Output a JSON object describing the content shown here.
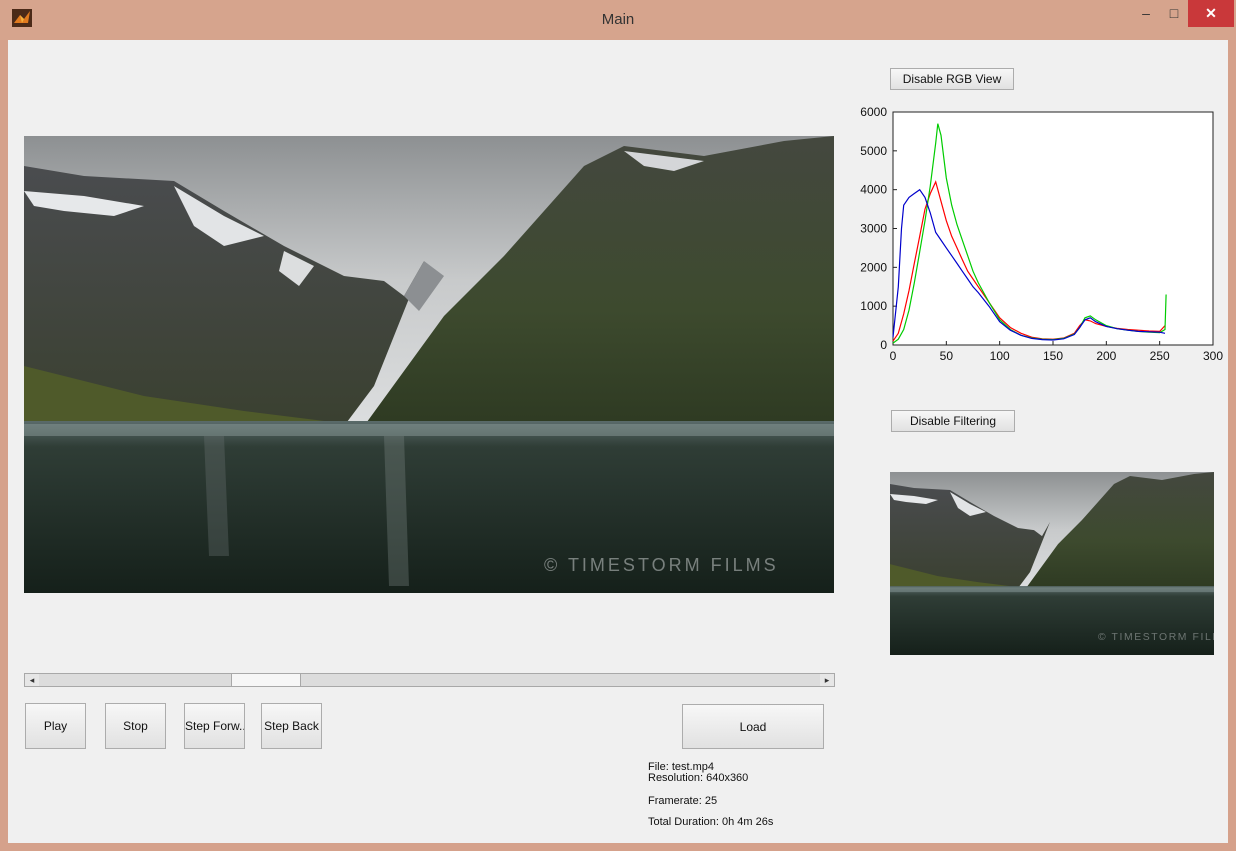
{
  "window": {
    "title": "Main",
    "controls": {
      "minimize": "–",
      "maximize": "□",
      "close": "✕"
    }
  },
  "buttons": {
    "rgb_view": "Disable RGB View",
    "filtering": "Disable Filtering",
    "play": "Play",
    "stop": "Stop",
    "step_forward": "Step Forw...",
    "step_back": "Step Back",
    "load": "Load"
  },
  "video": {
    "watermark": "© TIMESTORM FILMS"
  },
  "slider": {
    "left_arrow": "◂",
    "right_arrow": "▸",
    "position": 0.27
  },
  "file_info": {
    "file": "File: test.mp4",
    "resolution": "Resolution: 640x360",
    "framerate": "Framerate: 25",
    "duration": "Total Duration: 0h 4m 26s"
  },
  "chart_data": {
    "type": "line",
    "xlim": [
      0,
      300
    ],
    "ylim": [
      0,
      6000
    ],
    "x_ticks": [
      "0",
      "50",
      "100",
      "150",
      "200",
      "250",
      "300"
    ],
    "y_ticks": [
      "0",
      "1000",
      "2000",
      "3000",
      "4000",
      "5000",
      "6000"
    ],
    "grid": false,
    "series": [
      {
        "color": "#ff0000",
        "x": [
          0,
          5,
          10,
          15,
          20,
          25,
          30,
          35,
          40,
          45,
          50,
          55,
          60,
          65,
          70,
          75,
          80,
          90,
          100,
          110,
          120,
          130,
          140,
          150,
          160,
          170,
          175,
          180,
          185,
          190,
          200,
          210,
          220,
          230,
          240,
          250,
          255
        ],
        "y": [
          100,
          300,
          800,
          1400,
          2100,
          2800,
          3500,
          3900,
          4200,
          3700,
          3200,
          2800,
          2500,
          2200,
          1900,
          1700,
          1500,
          1100,
          700,
          450,
          300,
          200,
          160,
          150,
          180,
          300,
          500,
          650,
          620,
          550,
          480,
          430,
          400,
          380,
          360,
          350,
          500
        ]
      },
      {
        "color": "#00cc00",
        "x": [
          0,
          5,
          10,
          15,
          20,
          25,
          30,
          35,
          40,
          42,
          45,
          50,
          55,
          60,
          65,
          70,
          75,
          80,
          90,
          100,
          110,
          120,
          130,
          140,
          150,
          160,
          170,
          175,
          180,
          185,
          190,
          200,
          210,
          220,
          230,
          240,
          250,
          255,
          256
        ],
        "y": [
          50,
          150,
          400,
          900,
          1600,
          2400,
          3200,
          4100,
          5200,
          5700,
          5400,
          4300,
          3600,
          3100,
          2700,
          2300,
          1900,
          1600,
          1100,
          650,
          400,
          250,
          180,
          150,
          140,
          170,
          280,
          450,
          700,
          750,
          650,
          500,
          420,
          380,
          350,
          330,
          320,
          400,
          1300
        ]
      },
      {
        "color": "#0000cc",
        "x": [
          0,
          5,
          8,
          10,
          15,
          20,
          25,
          30,
          35,
          40,
          45,
          50,
          55,
          60,
          65,
          70,
          75,
          80,
          90,
          100,
          110,
          120,
          130,
          140,
          150,
          160,
          170,
          175,
          180,
          185,
          190,
          200,
          210,
          220,
          230,
          240,
          250,
          255
        ],
        "y": [
          200,
          1500,
          3000,
          3600,
          3800,
          3900,
          4000,
          3800,
          3400,
          2900,
          2700,
          2500,
          2300,
          2100,
          1900,
          1700,
          1500,
          1350,
          1000,
          600,
          380,
          250,
          170,
          140,
          130,
          160,
          270,
          450,
          650,
          700,
          600,
          480,
          420,
          380,
          350,
          340,
          330,
          300
        ]
      }
    ]
  }
}
